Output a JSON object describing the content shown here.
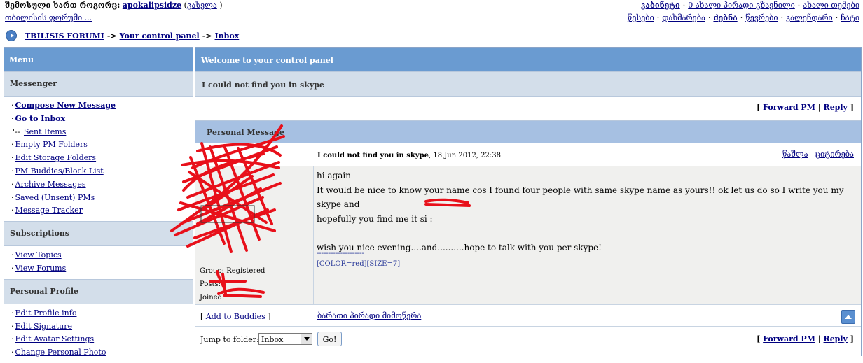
{
  "top": {
    "logged_in_label": "შემოსული ხართ როგორც:",
    "username": "apokalipsidze",
    "logout_label": "გასვლა",
    "forum_name_link": "თბილისის ფორუმი ...",
    "right_line1": [
      "კაბინეტი",
      "0 ახალი პირადი გზავნილი",
      "ახალი თემები"
    ],
    "right_line2": [
      "წესები",
      "დახმარება",
      "ძებნა",
      "წევრები",
      "კალენდარი",
      "ჩატი"
    ]
  },
  "breadcrumb": {
    "items": [
      "TBILISIS FORUMI",
      "Your control panel",
      "Inbox"
    ],
    "separator": "->"
  },
  "menu": {
    "title": "Menu",
    "sections": [
      {
        "title": "Messenger",
        "items": [
          "Compose New Message",
          "Go to Inbox",
          "Sent Items",
          "Empty PM Folders",
          "Edit Storage Folders",
          "PM Buddies/Block List",
          "Archive Messages",
          "Saved (Unsent) PMs",
          "Message Tracker"
        ]
      },
      {
        "title": "Subscriptions",
        "items": [
          "View Topics",
          "View Forums"
        ]
      },
      {
        "title": "Personal Profile",
        "items": [
          "Edit Profile info",
          "Edit Signature",
          "Edit Avatar Settings",
          "Change Personal Photo"
        ]
      }
    ]
  },
  "panel": {
    "title": "Welcome to your control panel",
    "subtitle": "I could not find you in skype",
    "forward_label": "Forward PM",
    "reply_label": "Reply",
    "pm_header": "Personal Message"
  },
  "message": {
    "title": "I could not find you in skype",
    "date": ", 18 Jun 2012, 22:38",
    "delete_label": "წაშლა",
    "quote_label": "ციტირება",
    "lines": [
      "hi again",
      "It would be nice to know your name cos I found four people with same skype name as yours!! ok let us do so I write you my skype and",
      "hopefully you find me it si :",
      "",
      "wish you nice evening....and..........hope to talk with you per skype!"
    ],
    "sig_line": "--------------------",
    "sig_text": "[COLOR=red][SIZE=7]",
    "author": {
      "group_label": "Group:",
      "group_value": "Registered",
      "posts_label": "Posts:",
      "joined_label": "Joined:"
    }
  },
  "bottom": {
    "add_buddy": "Add to Buddies",
    "pm_history": "ბარათი პირადი მიმოწერა",
    "jump_label": "Jump to folder:",
    "folder_selected": "Inbox",
    "go_label": "Go!"
  },
  "colors": {
    "header_blue": "#6a9bd1",
    "section_bg": "#d3deea",
    "link_color": "#000080",
    "scribble_red": "#e8101a"
  }
}
